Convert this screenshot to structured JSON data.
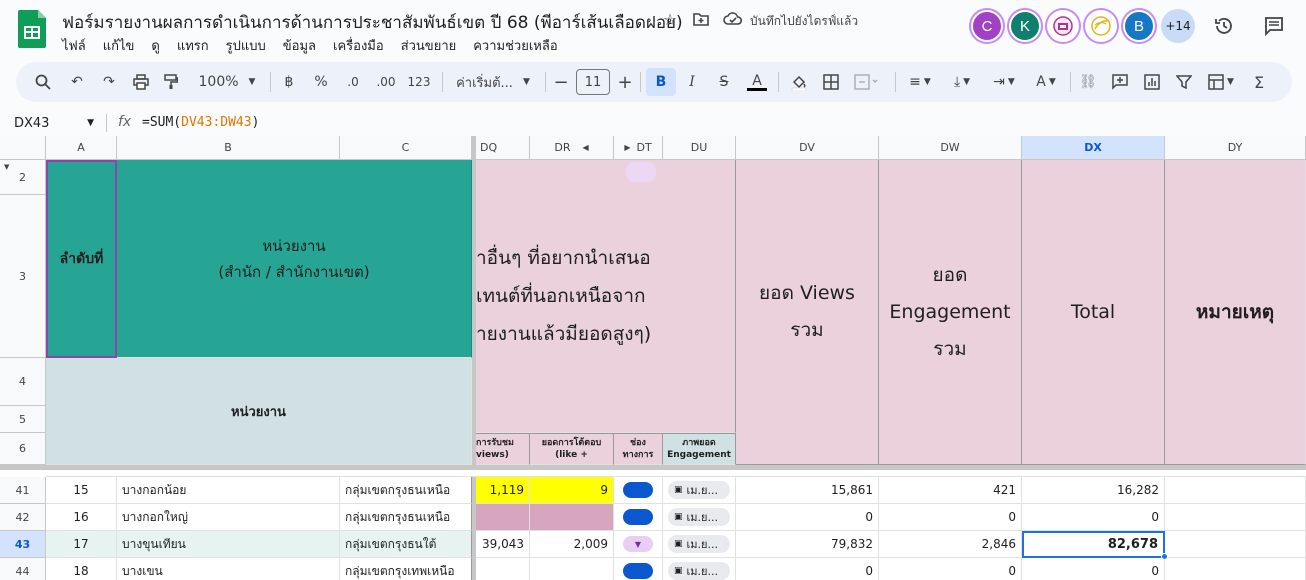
{
  "doc": {
    "title": "ฟอร์มรายงานผลการดำเนินการด้านการประชาสัมพันธ์เขต ปี 68 (พีอาร์เส้นเลือดฝอย)",
    "save_status": "บันทึกไปยังไดรฟ์แล้ว"
  },
  "menu": [
    "ไฟล์",
    "แก้ไข",
    "ดู",
    "แทรก",
    "รูปแบบ",
    "ข้อมูล",
    "เครื่องมือ",
    "ส่วนขยาย",
    "ความช่วยเหลือ"
  ],
  "collaborators": [
    {
      "initial": "C",
      "color": "#a142c4"
    },
    {
      "initial": "K",
      "color": "#0f8070"
    },
    {
      "initial": "",
      "color": "#ffffff"
    },
    {
      "initial": "",
      "color": "#ffffff"
    },
    {
      "initial": "B",
      "color": "#1777c4"
    }
  ],
  "collab_more": "+14",
  "toolbar": {
    "zoom": "100%",
    "currency": "฿",
    "percent": "%",
    "dec_dec": ".0",
    "dec_inc": ".00",
    "number_fmt": "123",
    "font": "ค่าเริ่มต้...",
    "font_size": "11"
  },
  "formula_bar": {
    "name_box": "DX43",
    "fx": "fx",
    "formula": "=SUM(DV43:DW43)"
  },
  "columns": {
    "A": "A",
    "B": "B",
    "C": "C",
    "DQ": "DQ",
    "DR": "DR",
    "DT": "DT",
    "DU": "DU",
    "DV": "DV",
    "DW": "DW",
    "DX": "DX",
    "DY": "DY"
  },
  "rows": {
    "r2": "2",
    "r3": "3",
    "r4": "4",
    "r5": "5",
    "r6": "6",
    "r41": "41",
    "r42": "42",
    "r43": "43",
    "r44": "44"
  },
  "header": {
    "seq": "ลำดับที่",
    "unit_line1": "หน่วยงาน",
    "unit_line2": "(สำนัก / สำนักงานเขต)",
    "unit_sub": "หน่วยงาน",
    "other_l1": "าอื่นๆ ที่อยากนำเสนอ",
    "other_l2": "เทนต์ที่นอกเหนือจาก",
    "other_l3": "ายงานแล้วมียอดสูงๆ)",
    "views_total_l1": "ยอด Views",
    "views_total_l2": "รวม",
    "eng_total_l1": "ยอด",
    "eng_total_l2": "Engagement",
    "eng_total_l3": "รวม",
    "total": "Total",
    "remark": "หมายเหตุ",
    "dq_sub1": "การรับชม",
    "dq_sub2": "views)",
    "dr_sub1": "ยอดการโต้ตอบ",
    "dr_sub2": "(like +",
    "dt_sub1": "ช่อง",
    "dt_sub2": "ทางการ",
    "du_sub1": "ภาพยอด",
    "du_sub2": "Engagement"
  },
  "table_rows": [
    {
      "seq": "15",
      "unit": "บางกอกน้อย",
      "group": "กลุ่มเขตกรุงธนเหนือ",
      "dq": "1,119",
      "dr": "9",
      "file": "เม.ย...",
      "dv": "15,861",
      "dw": "421",
      "dx": "16,282"
    },
    {
      "seq": "16",
      "unit": "บางกอกใหญ่",
      "group": "กลุ่มเขตกรุงธนเหนือ",
      "dq": "",
      "dr": "",
      "file": "เม.ย...",
      "dv": "0",
      "dw": "0",
      "dx": "0"
    },
    {
      "seq": "17",
      "unit": "บางขุนเทียน",
      "group": "กลุ่มเขตกรุงธนใต้",
      "dq": "39,043",
      "dr": "2,009",
      "file": "เม.ย...",
      "dv": "79,832",
      "dw": "2,846",
      "dx": "82,678"
    },
    {
      "seq": "18",
      "unit": "บางเขน",
      "group": "กลุ่มเขตกรุงเทพเหนือ",
      "dq": "",
      "dr": "",
      "file": "เม.ย...",
      "dv": "0",
      "dw": "0",
      "dx": "0"
    }
  ],
  "colors": {
    "teal": "#27a594",
    "pink": "#ead1dc",
    "selection": "#1a73e8",
    "highlight": "#ffff00"
  }
}
